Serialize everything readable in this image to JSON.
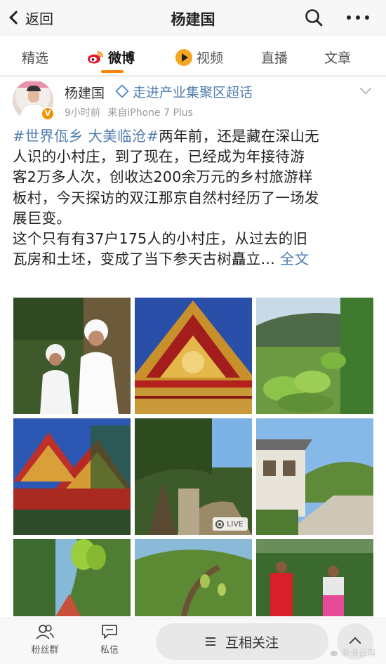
{
  "header": {
    "back_label": "返回",
    "title": "杨建国"
  },
  "tabs": [
    {
      "label": "精选"
    },
    {
      "label": "微博",
      "active": true
    },
    {
      "label": "视频"
    },
    {
      "label": "直播"
    },
    {
      "label": "文章"
    }
  ],
  "post": {
    "author": "杨建国",
    "super_topic": "走进产业集聚区超话",
    "time": "9小时前",
    "source": "来自iPhone 7 Plus",
    "hashtags": "#世界佤乡 大美临沧#",
    "line1_rest": "两年前，还是藏在深山无",
    "line2": "人识的小村庄，到了现在，已经成为年接待游",
    "line3": "客2万多人次，创收达200余万元的乡村旅游样",
    "line4": "板村，今天探访的双江那京自然村经历了一场发",
    "line5": "展巨变。",
    "line6": "这个只有有37户175人的小村庄，从过去的旧",
    "line7": "瓦房和土坯，变成了当下参天古树矗立...",
    "full_text_link": "全文",
    "live_label": "LIVE"
  },
  "bottom_bar": {
    "fans_group": "粉丝群",
    "message": "私信",
    "follow": "互相关注"
  },
  "watermark": "新浪云南",
  "colors": {
    "accent": "#ff8200",
    "link": "#507daf",
    "vip": "#f19100"
  }
}
